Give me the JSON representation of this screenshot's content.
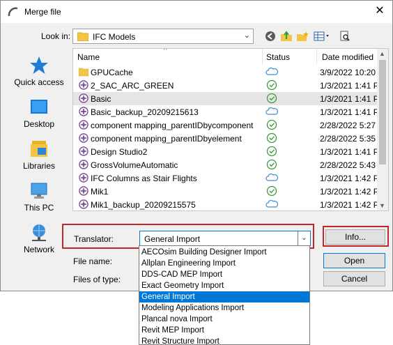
{
  "window": {
    "title": "Merge file",
    "close_glyph": "✕"
  },
  "lookin": {
    "label": "Look in:",
    "value": "IFC Models"
  },
  "toolbar": {
    "icons": [
      "back-icon",
      "up-folder-icon",
      "new-folder-icon",
      "view-menu-icon",
      "preview-icon"
    ]
  },
  "places": [
    {
      "label": "Quick access",
      "icon": "quick-access-star-icon"
    },
    {
      "label": "Desktop",
      "icon": "desktop-icon"
    },
    {
      "label": "Libraries",
      "icon": "libraries-icon"
    },
    {
      "label": "This PC",
      "icon": "this-pc-icon"
    },
    {
      "label": "Network",
      "icon": "network-icon"
    }
  ],
  "file_list": {
    "columns": {
      "name": "Name",
      "status": "Status",
      "date": "Date modified"
    },
    "rows": [
      {
        "name": "GPUCache",
        "kind": "folder",
        "status": "cloud",
        "date": "3/9/2022 10:20"
      },
      {
        "name": "2_SAC_ARC_GREEN",
        "kind": "file",
        "status": "synced",
        "date": "1/3/2021 1:41 P"
      },
      {
        "name": "Basic",
        "kind": "file",
        "status": "synced",
        "date": "1/3/2021 1:41 P",
        "selected": true
      },
      {
        "name": "Basic_backup_20209215613",
        "kind": "file",
        "status": "cloud",
        "date": "1/3/2021 1:41 P"
      },
      {
        "name": "component mapping_parentIDbycomponent",
        "kind": "file",
        "status": "synced",
        "date": "2/28/2022 5:27"
      },
      {
        "name": "component mapping_parentIDbyelement",
        "kind": "file",
        "status": "synced",
        "date": "2/28/2022 5:35"
      },
      {
        "name": "Design Studio2",
        "kind": "file",
        "status": "synced",
        "date": "1/3/2021 1:41 P"
      },
      {
        "name": "GrossVolumeAutomatic",
        "kind": "file",
        "status": "synced",
        "date": "2/28/2022 5:43"
      },
      {
        "name": "IFC Columns as Stair Flights",
        "kind": "file",
        "status": "cloud",
        "date": "1/3/2021 1:42 P"
      },
      {
        "name": "Mik1",
        "kind": "file",
        "status": "synced",
        "date": "1/3/2021 1:42 P"
      },
      {
        "name": "Mik1_backup_20209215575",
        "kind": "file",
        "status": "cloud",
        "date": "1/3/2021 1:42 P"
      }
    ]
  },
  "translator": {
    "label": "Translator:",
    "value": "General Import",
    "options": [
      "AECOsim Building Designer Import",
      "Allplan Engineering Import",
      "DDS-CAD MEP Import",
      "Exact Geometry Import",
      "General Import",
      "Modeling Applications Import",
      "Plancal nova Import",
      "Revit MEP Import",
      "Revit Structure Import"
    ],
    "selected_index": 4
  },
  "fields": {
    "file_name_label": "File name:",
    "files_of_type_label": "Files of type:"
  },
  "buttons": {
    "info": "Info...",
    "open": "Open",
    "cancel": "Cancel"
  },
  "colors": {
    "highlight_frame": "#c0262d",
    "selection_blue": "#0078d7",
    "synced_green": "#3a9a3a",
    "cloud_blue": "#3b8fd4"
  }
}
